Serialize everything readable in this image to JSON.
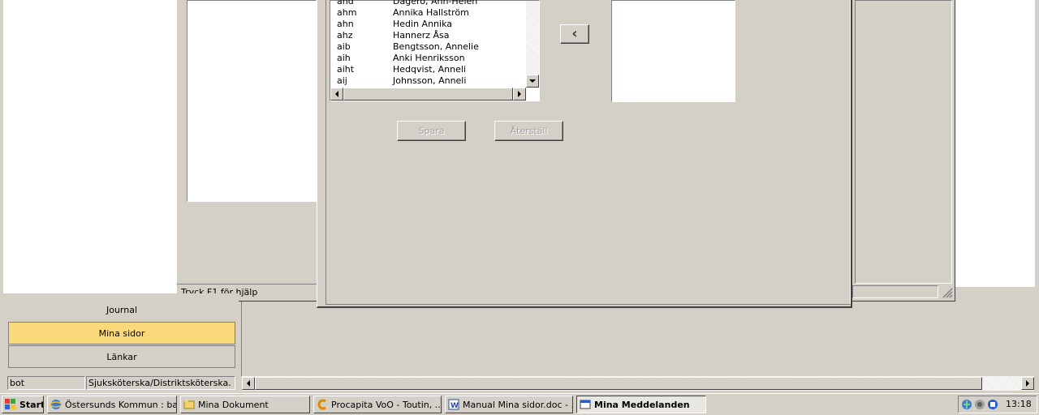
{
  "list": {
    "rows": [
      {
        "code": "and",
        "name": "Dagerö, Ann-Helen"
      },
      {
        "code": "ahm",
        "name": "Annika Hallström"
      },
      {
        "code": "ahn",
        "name": "Hedin Annika"
      },
      {
        "code": "ahz",
        "name": "Hannerz Åsa"
      },
      {
        "code": "aib",
        "name": "Bengtsson, Annelie"
      },
      {
        "code": "aih",
        "name": "Anki Henriksson"
      },
      {
        "code": "aiht",
        "name": "Hedqvist, Anneli"
      },
      {
        "code": "aij",
        "name": "Johnsson, Anneli"
      }
    ]
  },
  "buttons": {
    "back_arrow": "‹",
    "save": "Spara",
    "reset": "Återställ"
  },
  "statusbar": {
    "help": "Tryck F1 för hjälp"
  },
  "nav": {
    "journal": "Journal",
    "mina_sidor": "Mina sidor",
    "lankar": "Länkar"
  },
  "user_status": {
    "user": "bot",
    "role": "Sjuksköterska/Distriktsköterska."
  },
  "taskbar": {
    "start": "Start",
    "items": [
      {
        "label": "Östersunds Kommun : ba...",
        "icon": "ie-icon"
      },
      {
        "label": "Mina Dokument",
        "icon": "folder-icon"
      },
      {
        "label": "Procapita VoO - Toutin, ...",
        "icon": "procapita-icon"
      },
      {
        "label": "Manual Mina sidor.doc - ...",
        "icon": "word-icon"
      },
      {
        "label": "Mina Meddelanden",
        "icon": "window-icon"
      }
    ],
    "clock": "13:18"
  },
  "colors": {
    "active_nav": "#fad97a",
    "face": "#d4d0c8",
    "taskbar_start": "#2d9c2d"
  }
}
